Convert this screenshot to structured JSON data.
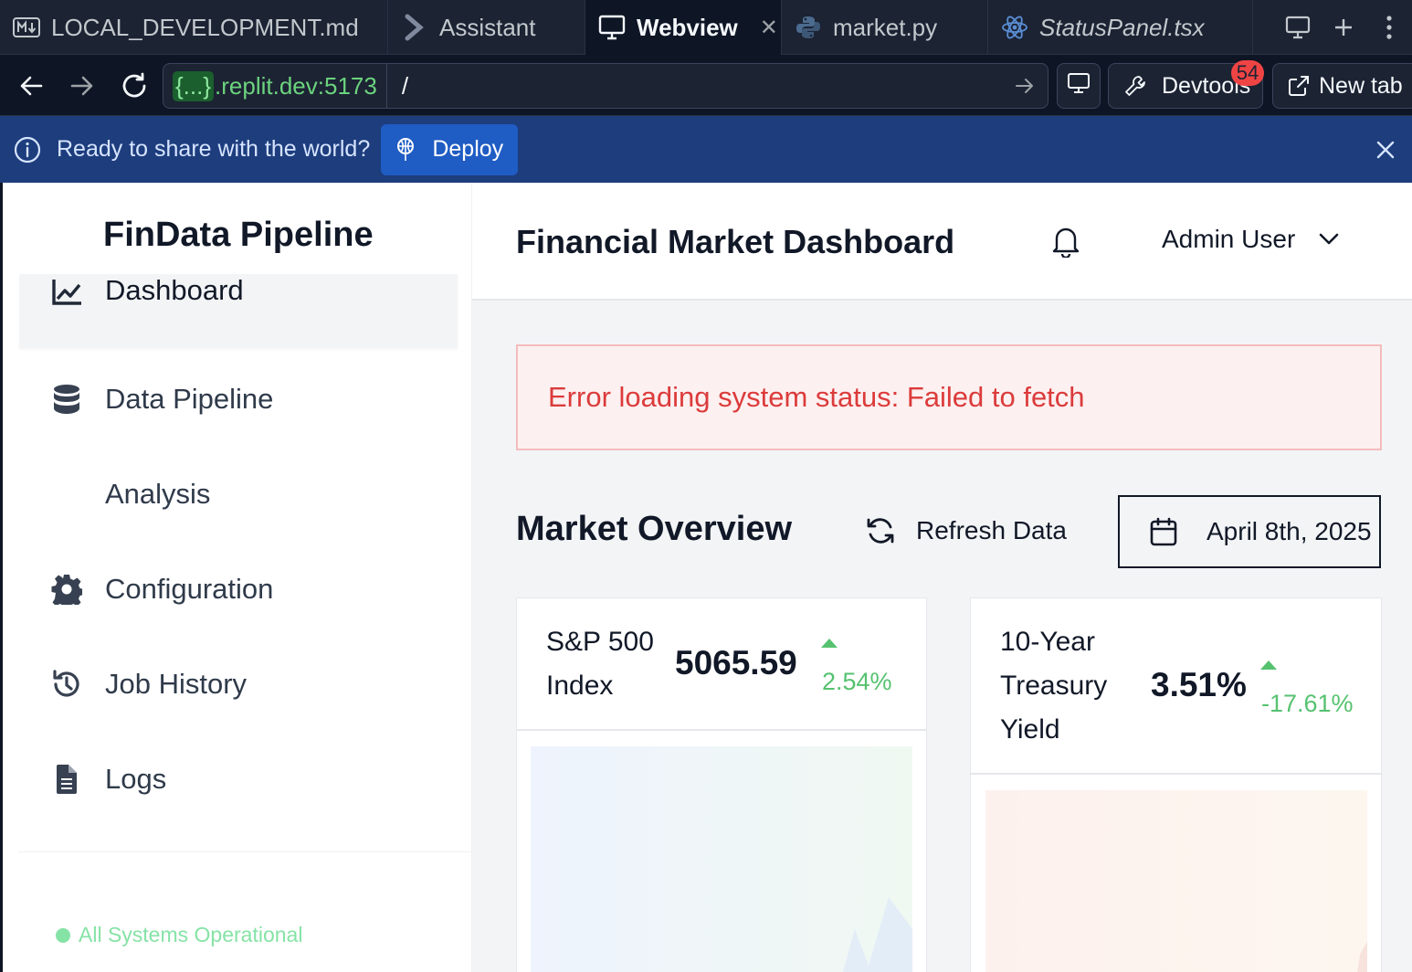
{
  "tabs": [
    {
      "label": "LOCAL_DEVELOPMENT.md",
      "icon": "markdown-icon",
      "active": false
    },
    {
      "label": "Assistant",
      "icon": "assistant-icon",
      "active": false
    },
    {
      "label": "Webview",
      "icon": "webview-icon",
      "active": true
    },
    {
      "label": "market.py",
      "icon": "python-icon",
      "active": false
    },
    {
      "label": "StatusPanel.tsx",
      "icon": "react-icon",
      "active": false
    }
  ],
  "address": {
    "host_tag": "{...}",
    "host": ".replit.dev:5173",
    "path": "/",
    "devtools_label": "Devtools",
    "devtools_badge": "54",
    "newtab_label": "New tab"
  },
  "banner": {
    "text": "Ready to share with the world?",
    "deploy_label": "Deploy"
  },
  "sidebar": {
    "brand": "FinData Pipeline",
    "items": [
      {
        "label": "Dashboard",
        "icon": "chart-line-icon",
        "active": true
      },
      {
        "label": "Data Pipeline",
        "icon": "database-icon",
        "active": false
      },
      {
        "label": "Analysis",
        "icon": "",
        "active": false
      },
      {
        "label": "Configuration",
        "icon": "gear-icon",
        "active": false
      },
      {
        "label": "Job History",
        "icon": "history-icon",
        "active": false
      },
      {
        "label": "Logs",
        "icon": "file-icon",
        "active": false
      }
    ],
    "status": "All Systems Operational"
  },
  "header": {
    "title": "Financial Market Dashboard",
    "user": "Admin User"
  },
  "main": {
    "error": "Error loading system status: Failed to fetch",
    "section_title": "Market Overview",
    "refresh_label": "Refresh Data",
    "date": "April 8th, 2025",
    "cards": [
      {
        "name": "S&P 500 Index",
        "value": "5065.59",
        "change": "2.54%",
        "trend": "up"
      },
      {
        "name": "10-Year Treasury Yield",
        "value": "3.51%",
        "change": "-17.61%",
        "trend": "up"
      }
    ]
  },
  "colors": {
    "accent": "#1f5cc4",
    "error": "#dc3b3b",
    "positive": "#56c270",
    "status_ok": "#86e3a6"
  }
}
